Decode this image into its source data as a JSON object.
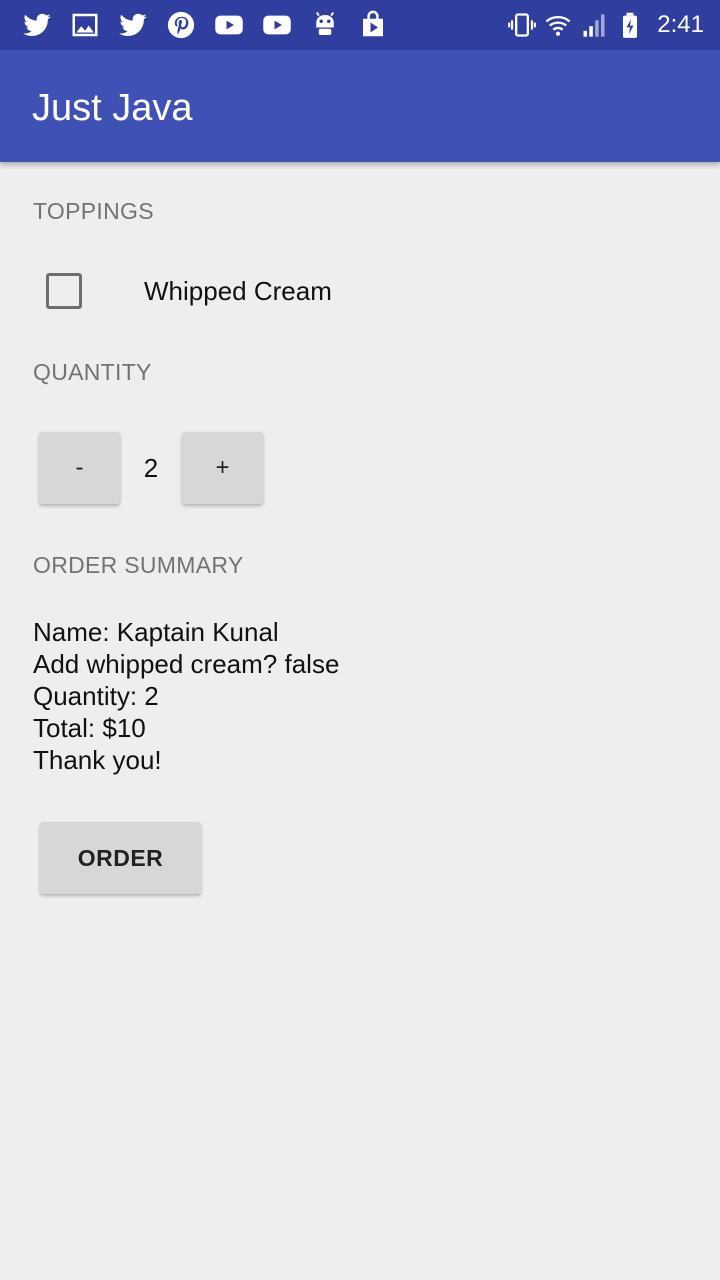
{
  "status_bar": {
    "left_icons": [
      "twitter-icon",
      "gallery-icon",
      "twitter-icon",
      "pinterest-icon",
      "youtube-icon",
      "youtube-icon",
      "android-icon",
      "play-store-icon"
    ],
    "right_icons": [
      "vibrate-icon",
      "wifi-icon",
      "signal-icon",
      "battery-charging-icon"
    ],
    "time": "2:41",
    "color": "#303f9f"
  },
  "app_bar": {
    "title": "Just Java",
    "color": "#3f51b5"
  },
  "toppings": {
    "header": "TOPPINGS",
    "whipped_cream": {
      "label": "Whipped Cream",
      "checked": false
    }
  },
  "quantity": {
    "header": "QUANTITY",
    "decrement_label": "-",
    "value": "2",
    "increment_label": "+"
  },
  "order_summary": {
    "header": "ORDER SUMMARY",
    "lines": [
      "Name: Kaptain Kunal",
      "Add whipped cream? false",
      "Quantity: 2",
      "Total: $10",
      "Thank you!"
    ]
  },
  "order_button": {
    "label": "ORDER"
  }
}
